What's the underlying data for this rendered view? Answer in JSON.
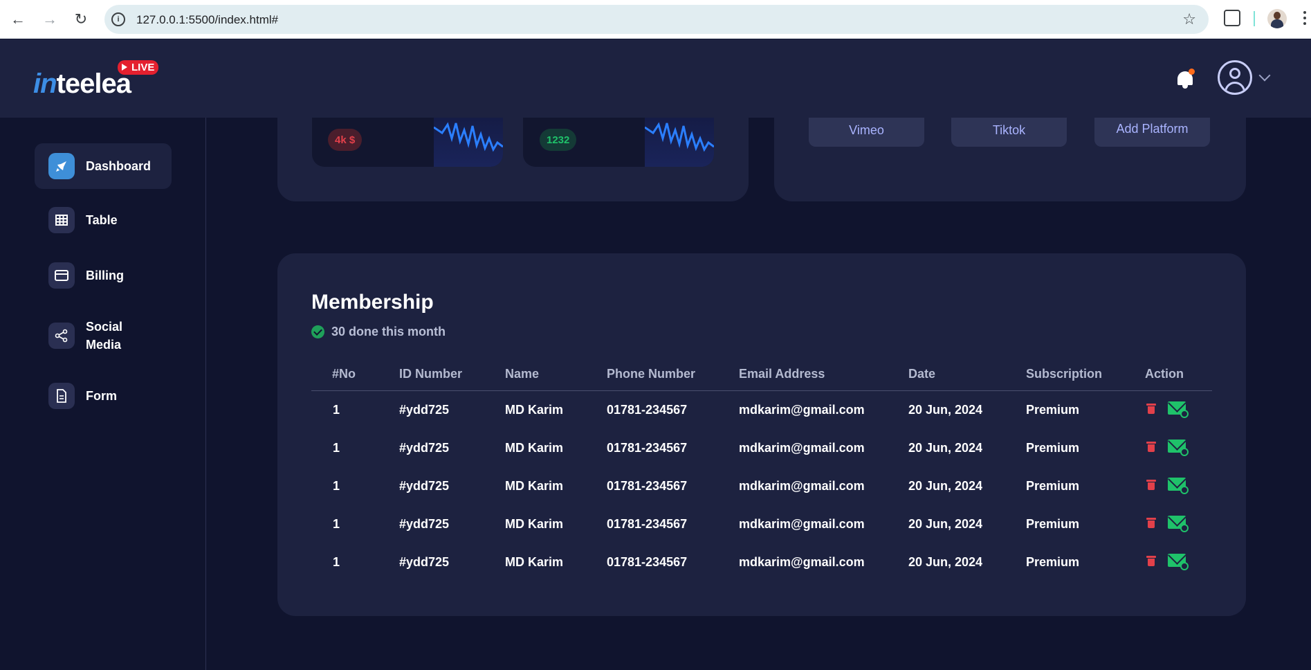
{
  "browser": {
    "url": "127.0.0.1:5500/index.html#"
  },
  "header": {
    "logo_text": "inteelea",
    "live_badge": "LIVE"
  },
  "sidebar": {
    "items": [
      {
        "label": "Dashboard",
        "icon": "rocket-icon",
        "active": true
      },
      {
        "label": "Table",
        "icon": "table-icon",
        "active": false
      },
      {
        "label": "Billing",
        "icon": "credit-card-icon",
        "active": false
      },
      {
        "label": "Social Media",
        "icon": "share-icon",
        "active": false
      },
      {
        "label": "Form",
        "icon": "document-icon",
        "active": false
      }
    ]
  },
  "stats": [
    {
      "badge": "4k $",
      "color": "#e2404a"
    },
    {
      "badge": "1232",
      "color": "#1fc26a"
    }
  ],
  "platforms": [
    "Vimeo",
    "Tiktok",
    "Add Platform"
  ],
  "membership": {
    "title": "Membership",
    "subtitle": "30 done this month",
    "columns": [
      "#No",
      "ID Number",
      "Name",
      "Phone Number",
      "Email Address",
      "Date",
      "Subscription",
      "Action"
    ],
    "rows": [
      {
        "no": "1",
        "id": "#ydd725",
        "name": "MD Karim",
        "phone": "01781-234567",
        "email": "mdkarim@gmail.com",
        "date": "20 Jun, 2024",
        "subscription": "Premium"
      },
      {
        "no": "1",
        "id": "#ydd725",
        "name": "MD Karim",
        "phone": "01781-234567",
        "email": "mdkarim@gmail.com",
        "date": "20 Jun, 2024",
        "subscription": "Premium"
      },
      {
        "no": "1",
        "id": "#ydd725",
        "name": "MD Karim",
        "phone": "01781-234567",
        "email": "mdkarim@gmail.com",
        "date": "20 Jun, 2024",
        "subscription": "Premium"
      },
      {
        "no": "1",
        "id": "#ydd725",
        "name": "MD Karim",
        "phone": "01781-234567",
        "email": "mdkarim@gmail.com",
        "date": "20 Jun, 2024",
        "subscription": "Premium"
      },
      {
        "no": "1",
        "id": "#ydd725",
        "name": "MD Karim",
        "phone": "01781-234567",
        "email": "mdkarim@gmail.com",
        "date": "20 Jun, 2024",
        "subscription": "Premium"
      }
    ]
  },
  "colors": {
    "background": "#10142e",
    "card": "#1d2240",
    "accent": "#3e8fd8",
    "danger": "#e2404a",
    "success": "#1fc26a"
  }
}
